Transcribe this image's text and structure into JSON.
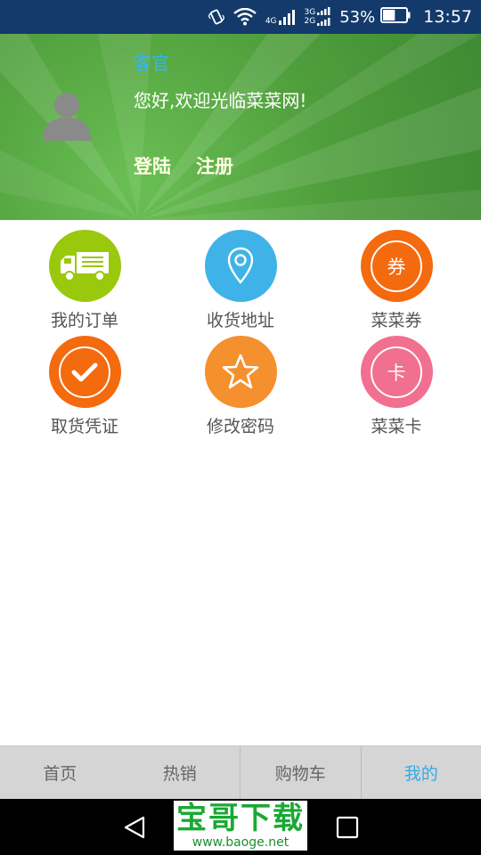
{
  "status_bar": {
    "net_4g": "4G",
    "net_3g": "3G",
    "net_2g": "2G",
    "battery_percent": "53%",
    "battery_level": 0.53,
    "time": "13:57",
    "icons": [
      "vibrate-icon",
      "wifi-icon",
      "signal-icon",
      "battery-icon"
    ]
  },
  "profile": {
    "guest_name": "客官",
    "welcome": "您好,欢迎光临菜菜网!",
    "login_label": "登陆",
    "register_label": "注册"
  },
  "menu": {
    "items": [
      {
        "label": "我的订单",
        "icon": "truck-icon",
        "color": "#99c80d"
      },
      {
        "label": "收货地址",
        "icon": "location-pin-icon",
        "color": "#3fb3e8"
      },
      {
        "label": "菜菜券",
        "icon": "coupon-icon",
        "icon_text": "券",
        "color": "#f46a0e"
      },
      {
        "label": "取货凭证",
        "icon": "check-icon",
        "color": "#f46a0e"
      },
      {
        "label": "修改密码",
        "icon": "star-icon",
        "color": "#f4902d"
      },
      {
        "label": "菜菜卡",
        "icon": "card-icon",
        "icon_text": "卡",
        "color": "#f16f8f"
      }
    ]
  },
  "tabbar": {
    "tabs": [
      {
        "label": "首页",
        "active": false
      },
      {
        "label": "热销",
        "active": false
      },
      {
        "label": "购物车",
        "active": false
      },
      {
        "label": "我的",
        "active": true
      }
    ],
    "active_color": "#35a9e6"
  },
  "watermark": {
    "title": "宝哥下载",
    "url": "www.baoge.net"
  }
}
